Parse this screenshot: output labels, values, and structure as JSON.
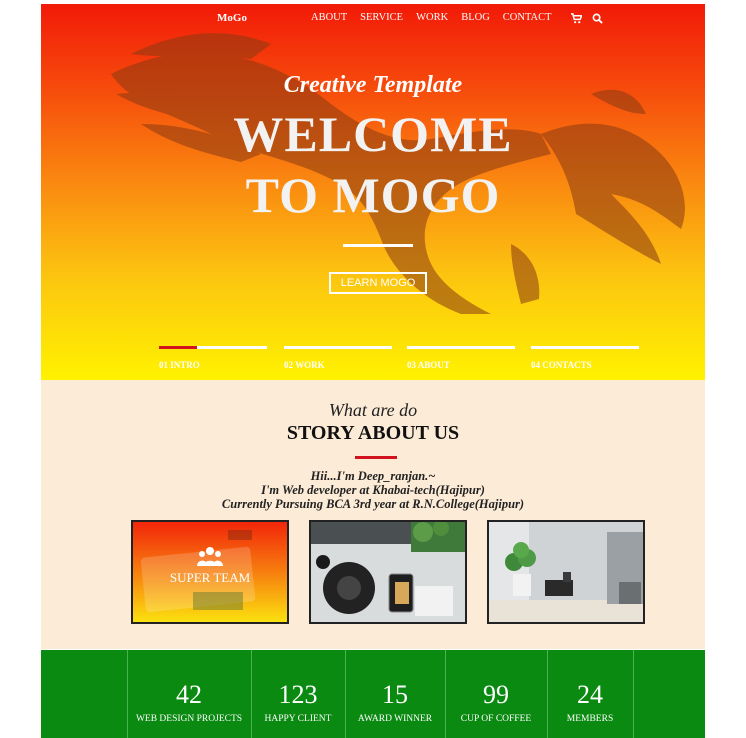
{
  "nav": {
    "brand": "MoGo",
    "links": [
      "ABOUT",
      "SERVICE",
      "WORK",
      "BLOG",
      "CONTACT"
    ],
    "icons": [
      "cart-icon",
      "search-icon"
    ]
  },
  "hero": {
    "subtitle": "Creative Template",
    "title_line1": "WELCOME",
    "title_line2": "TO MOGO",
    "button": "LEARN MOGO",
    "slides": [
      {
        "label": "01 INTRO",
        "progress": 0.35
      },
      {
        "label": "02 WORK",
        "progress": 0
      },
      {
        "label": "03 ABOUT",
        "progress": 0
      },
      {
        "label": "04 CONTACTS",
        "progress": 0
      }
    ]
  },
  "about": {
    "kicker": "What are do",
    "title": "STORY ABOUT US",
    "bio": [
      "Hii...I'm Deep_ranjan.~",
      "I'm Web developer at Khabai-tech(Hajipur)",
      "Currently Pursuing BCA 3rd year at R.N.College(Hajipur)"
    ],
    "cards": [
      {
        "label": "SUPER TEAM"
      },
      {
        "label": ""
      },
      {
        "label": ""
      }
    ]
  },
  "stats": [
    {
      "value": "42",
      "label": "WEB DESIGN PROJECTS"
    },
    {
      "value": "123",
      "label": "HAPPY CLIENT"
    },
    {
      "value": "15",
      "label": "AWARD WINNER"
    },
    {
      "value": "99",
      "label": "CUP OF COFFEE"
    },
    {
      "value": "24",
      "label": "MEMBERS"
    }
  ],
  "colors": {
    "accent": "#d0131d",
    "stats_bg": "#0b8a12",
    "about_bg": "#fcebd6"
  }
}
